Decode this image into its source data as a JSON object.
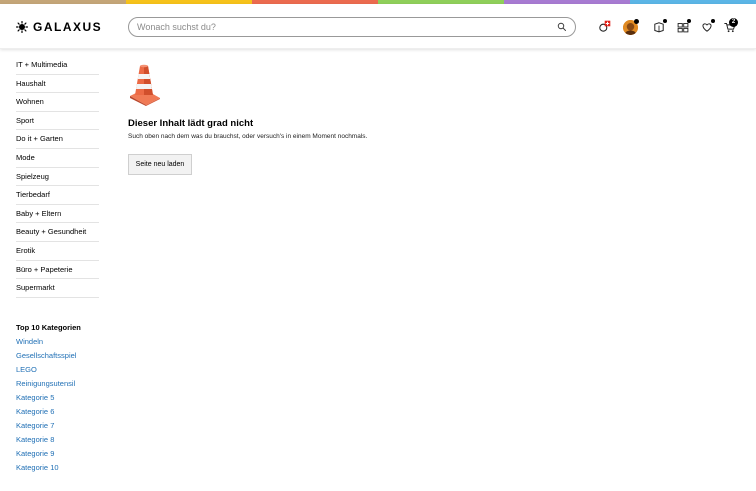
{
  "stripe_colors": [
    "#c4a578",
    "#f6c21b",
    "#eb6b4f",
    "#8fcf5a",
    "#a77bd2",
    "#5bb5e6"
  ],
  "header": {
    "logo": "GALAXUS",
    "search": {
      "placeholder": "Wonach suchst du?",
      "value": ""
    },
    "cart_count": "2"
  },
  "sidebar": {
    "items": [
      "IT + Multimedia",
      "Haushalt",
      "Wohnen",
      "Sport",
      "Do it + Garten",
      "Mode",
      "Spielzeug",
      "Tierbedarf",
      "Baby + Eltern",
      "Beauty + Gesundheit",
      "Erotik",
      "Büro + Papeterie",
      "Supermarkt"
    ]
  },
  "top10": {
    "heading": "Top 10 Kategorien",
    "links": [
      "Windeln",
      "Gesellschaftsspiel",
      "LEGO",
      "Reinigungsutensil",
      "Kategorie 5",
      "Kategorie 6",
      "Kategorie 7",
      "Kategorie 8",
      "Kategorie 9",
      "Kategorie 10"
    ]
  },
  "error": {
    "title": "Dieser Inhalt lädt grad nicht",
    "text": "Such oben nach dem was du brauchst, oder versuch's in einem Moment nochmals.",
    "button": "Seite neu laden"
  },
  "icons": {
    "logo": "sun-icon",
    "search": "search-icon",
    "swiss": "swiss-cross-icon",
    "account": "avatar-icon",
    "orders": "package-icon",
    "compare": "compare-icon",
    "wishlist": "heart-icon",
    "cart": "cart-icon",
    "error": "traffic-cone-icon"
  }
}
